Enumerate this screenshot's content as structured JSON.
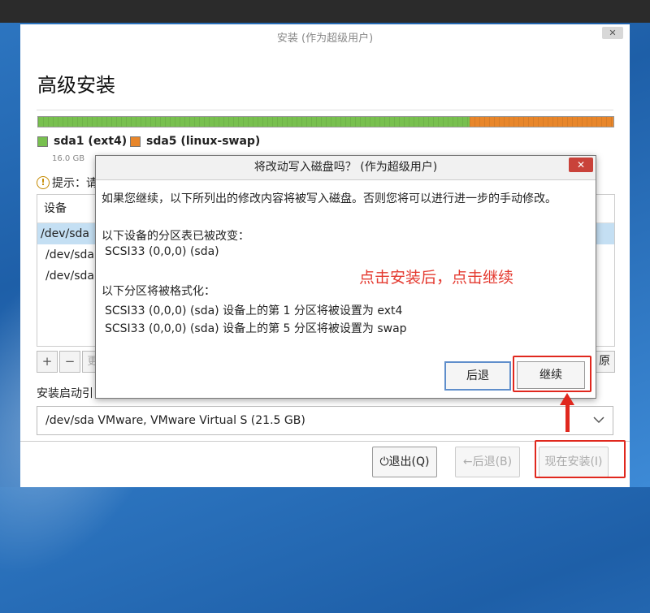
{
  "window": {
    "title": "安装 (作为超级用户)",
    "close_label": "✕",
    "heading": "高级安装"
  },
  "disk": {
    "partitions": [
      {
        "label": "sda1 (ext4)",
        "color": "#78c04f",
        "size": "16.0 GB"
      },
      {
        "label": "sda5 (linux-swap)",
        "color": "#e8862a"
      }
    ]
  },
  "hint": {
    "text": "提示：请"
  },
  "table": {
    "header": "设备",
    "rows": [
      "/dev/sda",
      "/dev/sda",
      "/dev/sda"
    ]
  },
  "toolbar": {
    "add": "+",
    "remove": "−",
    "change": "更",
    "revert": "原"
  },
  "boot": {
    "label": "安装启动引",
    "selected": "/dev/sda   VMware, VMware Virtual S (21.5 GB)"
  },
  "footer": {
    "quit": "⏻退出(Q)",
    "back": "←后退(B)",
    "install": "现在安装(I)"
  },
  "dialog": {
    "title": "将改动写入磁盘吗？ (作为超级用户)",
    "close_label": "✕",
    "intro": "如果您继续，以下所列出的修改内容将被写入磁盘。否则您将可以进行进一步的手动修改。",
    "table_changed_title": "以下设备的分区表已被改变：",
    "table_changed_device": "SCSI33 (0,0,0) (sda)",
    "format_title": "以下分区将被格式化：",
    "format_items": [
      "SCSI33 (0,0,0) (sda) 设备上的第 1 分区将被设置为 ext4",
      "SCSI33 (0,0,0) (sda) 设备上的第 5 分区将被设置为 swap"
    ],
    "back_label": "后退",
    "continue_label": "继续"
  },
  "annotation": {
    "text": "点击安装后，点击继续",
    "color": "#e43a30"
  }
}
